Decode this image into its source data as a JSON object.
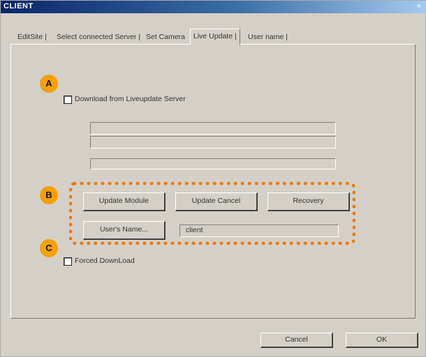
{
  "window": {
    "title": "CLIENT",
    "close_glyph": "×"
  },
  "tabs": [
    {
      "label": "EditSite |"
    },
    {
      "label": "Select connected Server |"
    },
    {
      "label": "Set Camera"
    },
    {
      "label": "Live Update |"
    },
    {
      "label": "User name |"
    }
  ],
  "markers": {
    "a": "A",
    "b": "B",
    "c": "C"
  },
  "download": {
    "checkbox_checked": false,
    "label": "Download from Liveupdate Server"
  },
  "buttons": {
    "update_module": "Update Module",
    "update_cancel": "Update Cancel",
    "recovery": "Recovery",
    "users_name": "User's Name...",
    "cancel": "Cancel",
    "ok": "OK"
  },
  "user_name_value": "client",
  "forced": {
    "checkbox_checked": false,
    "label": "Forced DownLoad"
  },
  "colors": {
    "highlight": "#f07800",
    "marker": "#f5a000",
    "dialog_bg": "#d4d0c8"
  }
}
